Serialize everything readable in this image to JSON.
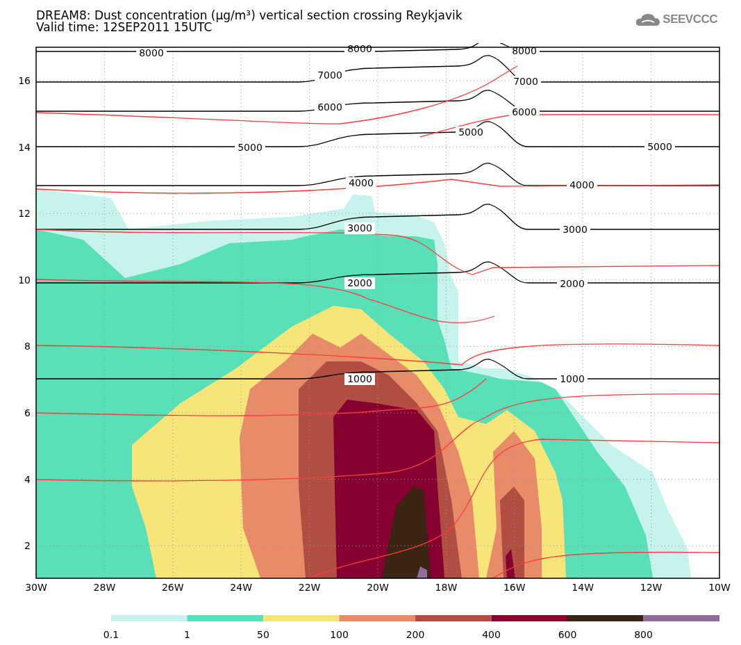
{
  "title": "DREAM8: Dust concentration (μg/m³) vertical section crossing Reykjavik",
  "subtitle": "Valid time: 12SEP2011 15UTC",
  "logo": {
    "text": "SEEVCCC"
  },
  "plot": {
    "y_ticks": [
      "16",
      "14",
      "12",
      "10",
      "8",
      "6",
      "4",
      "2"
    ],
    "x_ticks": [
      "30W",
      "28W",
      "26W",
      "24W",
      "22W",
      "20W",
      "18W",
      "16W",
      "14W",
      "12W",
      "10W"
    ],
    "contour_labels": [
      "8000",
      "8000",
      "8000",
      "7000",
      "7000",
      "6000",
      "6000",
      "5000",
      "5000",
      "5000",
      "4000",
      "4000",
      "3000",
      "3000",
      "2000",
      "2000",
      "1000",
      "1000"
    ]
  },
  "colorbar": [
    {
      "color": "#c6f3ec",
      "label": "0.1"
    },
    {
      "color": "#5ae0b8",
      "label": "1"
    },
    {
      "color": "#f8e57a",
      "label": "50"
    },
    {
      "color": "#e88b68",
      "label": "100"
    },
    {
      "color": "#b04e42",
      "label": "200"
    },
    {
      "color": "#850030",
      "label": "400"
    },
    {
      "color": "#3a2414",
      "label": "600"
    },
    {
      "color": "#8f6c9c",
      "label": "800"
    }
  ]
}
